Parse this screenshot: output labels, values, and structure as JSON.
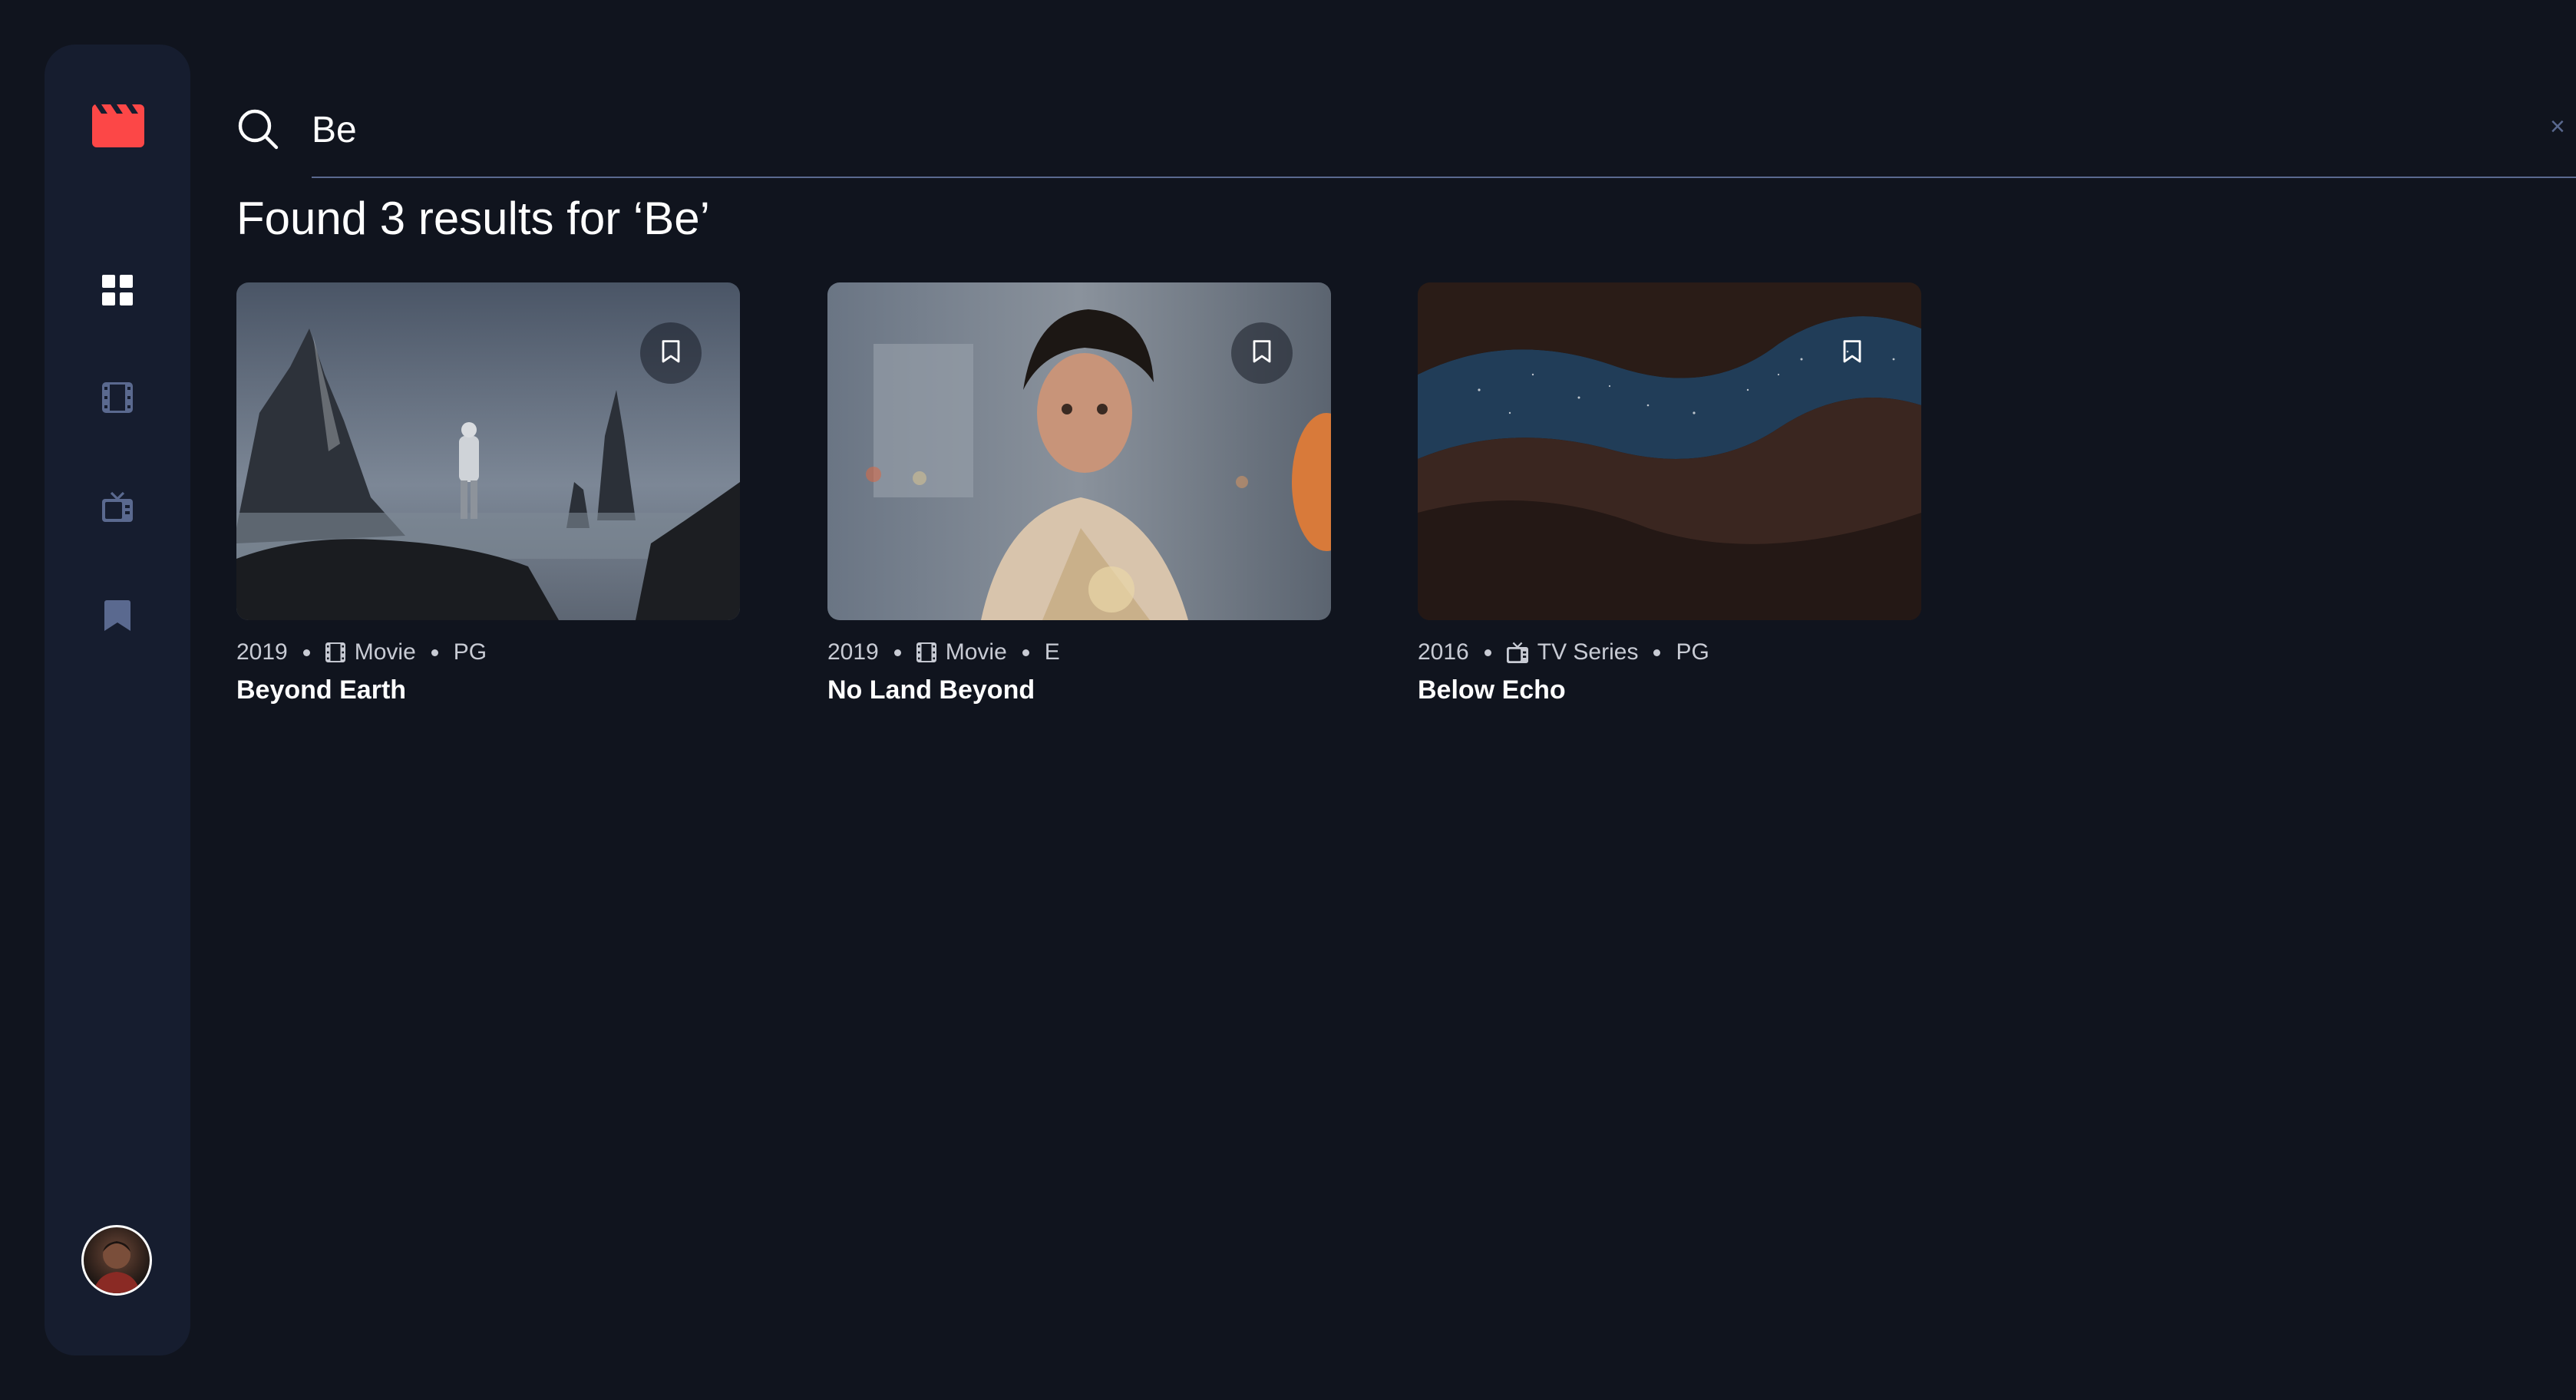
{
  "colors": {
    "background": "#10141e",
    "sidebar": "#161d2f",
    "accent": "#fc4747",
    "muted": "#5a698f"
  },
  "search": {
    "value": "Be",
    "placeholder": "Search for movies or TV series"
  },
  "results_heading": "Found 3 results for ‘Be’",
  "sidebar": {
    "logo": "clapperboard-icon",
    "items": [
      {
        "name": "home",
        "icon": "grid-icon",
        "active": true
      },
      {
        "name": "movies",
        "icon": "film-icon"
      },
      {
        "name": "tv-series",
        "icon": "tv-icon"
      },
      {
        "name": "bookmarks",
        "icon": "bookmark-icon"
      }
    ]
  },
  "results": [
    {
      "year": "2019",
      "category": "Movie",
      "category_icon": "film-icon",
      "rating": "PG",
      "title": "Beyond Earth"
    },
    {
      "year": "2019",
      "category": "Movie",
      "category_icon": "film-icon",
      "rating": "E",
      "title": "No Land Beyond"
    },
    {
      "year": "2016",
      "category": "TV Series",
      "category_icon": "tv-icon",
      "rating": "PG",
      "title": "Below Echo"
    }
  ]
}
